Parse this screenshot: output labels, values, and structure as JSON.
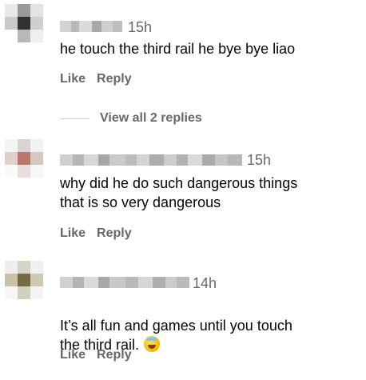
{
  "comments": [
    {
      "timestamp": "15h",
      "text": "he touch the third rail he bye bye liao",
      "like_label": "Like",
      "reply_label": "Reply",
      "view_replies_label": "View all 2 replies"
    },
    {
      "timestamp": "15h",
      "text": "why did he do such dangerous things\nthat is so very dangerous",
      "like_label": "Like",
      "reply_label": "Reply"
    },
    {
      "timestamp": "14h",
      "text": "It’s all fun and games until you touch\nthe third rail.",
      "like_label": "Like",
      "reply_label": "Reply",
      "emoji": "grinning-face-with-sweat-emoji"
    }
  ],
  "colors": {
    "meta_text": "#65676b",
    "body_text": "#050505",
    "divider": "#ced0d4"
  }
}
